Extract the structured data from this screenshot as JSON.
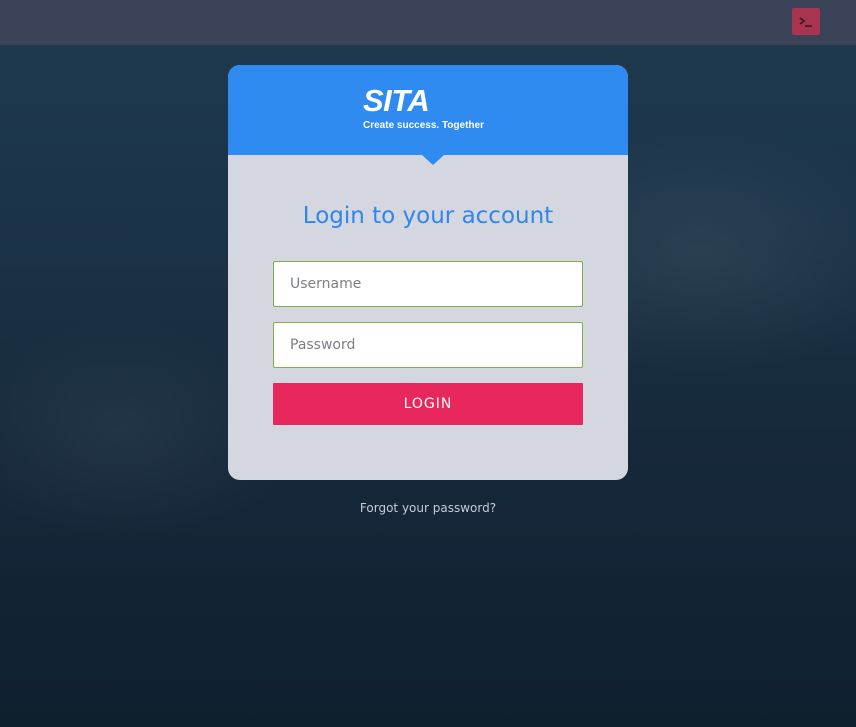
{
  "topbar": {
    "terminal_icon": "terminal-icon",
    "terminal_color": "#a8344f"
  },
  "brand": {
    "logo_text": "SITA",
    "tagline": "Create success. Together",
    "header_color": "#2f8bef"
  },
  "login": {
    "title": "Login to your account",
    "username_placeholder": "Username",
    "password_placeholder": "Password",
    "button_label": "LOGIN",
    "button_color": "#e8285c",
    "forgot_link": "Forgot your password?"
  }
}
